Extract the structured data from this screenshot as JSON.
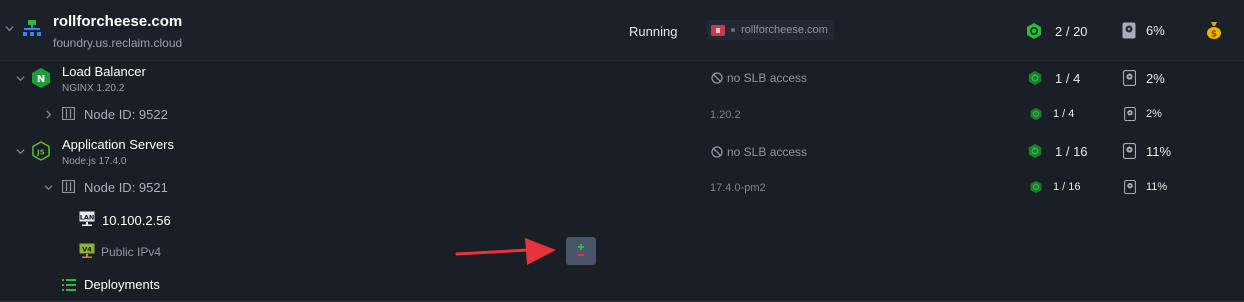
{
  "environment": {
    "name": "rollforcheese.com",
    "domain": "foundry.us.reclaim.cloud",
    "status": "Running",
    "domain_tag": "rollforcheese.com",
    "cloudlets": "2 / 20",
    "disk": "6%"
  },
  "load_balancer": {
    "name": "Load Balancer",
    "version": "NGINX 1.20.2",
    "slb": "no SLB access",
    "cloudlets": "1 / 4",
    "disk": "2%",
    "node": {
      "label": "Node ID: 9522",
      "version": "1.20.2",
      "cloudlets": "1 / 4",
      "disk": "2%"
    }
  },
  "app_servers": {
    "name": "Application Servers",
    "version": "Node.js 17.4.0",
    "slb": "no SLB access",
    "cloudlets": "1 / 16",
    "disk": "11%",
    "node": {
      "label": "Node ID: 9521",
      "version": "17.4.0-pm2",
      "cloudlets": "1 / 16",
      "disk": "11%"
    }
  },
  "ip": {
    "lan": "10.100.2.56",
    "public": "Public IPv4"
  },
  "deployments": "Deployments",
  "colors": {
    "accent_green": "#2dbb3f",
    "arrow_red": "#e8333a",
    "bg": "#161a21"
  }
}
